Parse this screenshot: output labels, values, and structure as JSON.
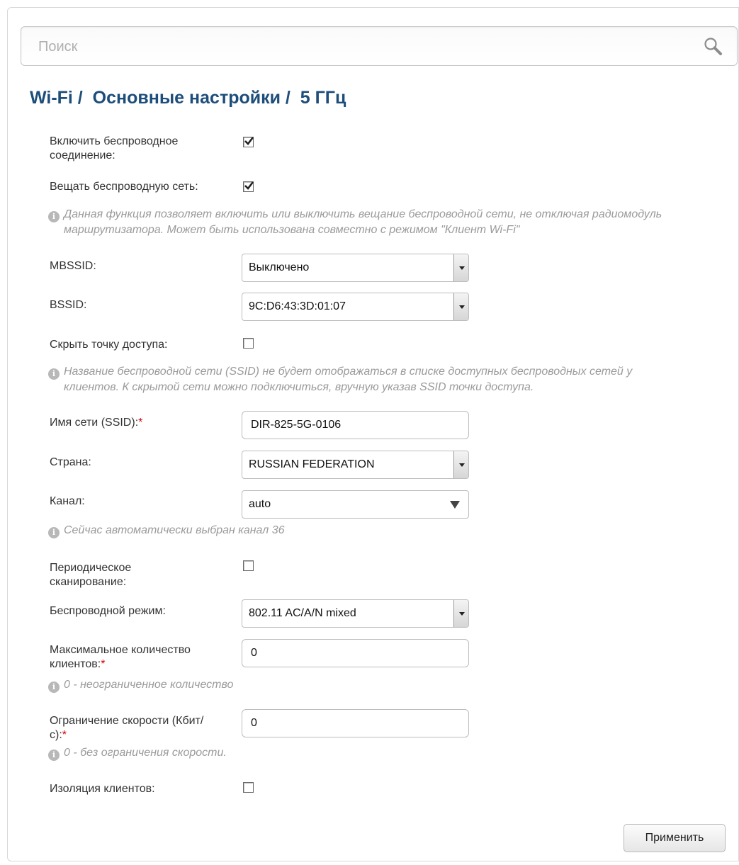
{
  "search": {
    "placeholder": "Поиск"
  },
  "page": {
    "title": "Wi-Fi /  Основные настройки /  5 ГГц"
  },
  "form": {
    "enable_wireless": {
      "label": "Включить беспроводное соединение:",
      "checked": true
    },
    "broadcast": {
      "label": "Вещать беспроводную сеть:",
      "checked": true,
      "hint": "Данная функция позволяет включить или выключить вещание беспроводной сети, не отключая радиомодуль маршрутизатора. Может быть использована совместно с режимом \"Клиент Wi-Fi\""
    },
    "mbssid": {
      "label": "MBSSID:",
      "value": "Выключено"
    },
    "bssid": {
      "label": "BSSID:",
      "value": "9C:D6:43:3D:01:07"
    },
    "hide_ap": {
      "label": "Скрыть точку доступа:",
      "checked": false,
      "hint": "Название беспроводной сети (SSID) не будет отображаться в списке доступных беспроводных сетей у клиентов. К скрытой сети можно подключиться, вручную указав SSID точки доступа."
    },
    "ssid": {
      "label": "Имя сети (SSID):",
      "required_mark": "*",
      "value": "DIR-825-5G-0106"
    },
    "country": {
      "label": "Страна:",
      "value": "RUSSIAN FEDERATION"
    },
    "channel": {
      "label": "Канал:",
      "value": "auto",
      "hint": "Сейчас автоматически выбран канал 36"
    },
    "periodic_scan": {
      "label": "Периодическое сканирование:",
      "checked": false
    },
    "wireless_mode": {
      "label": "Беспроводной режим:",
      "value": "802.11 AC/A/N mixed"
    },
    "max_clients": {
      "label": "Максимальное количество клиентов:",
      "required_mark": "*",
      "value": "0",
      "hint": "0 - неограниченное количество"
    },
    "speed_limit": {
      "label": "Ограничение скорости (Кбит/с):",
      "required_mark": "*",
      "value": "0",
      "hint": "0 - без ограничения скорости."
    },
    "client_isolation": {
      "label": "Изоляция клиентов:",
      "checked": false
    }
  },
  "actions": {
    "apply_label": "Применить"
  },
  "colors": {
    "title": "#1d4d7a",
    "required": "#d00000",
    "hint": "#9a9a9a"
  },
  "icons": {
    "search": "search-icon",
    "info": "info-icon",
    "dropdown": "chevron-down-icon"
  }
}
